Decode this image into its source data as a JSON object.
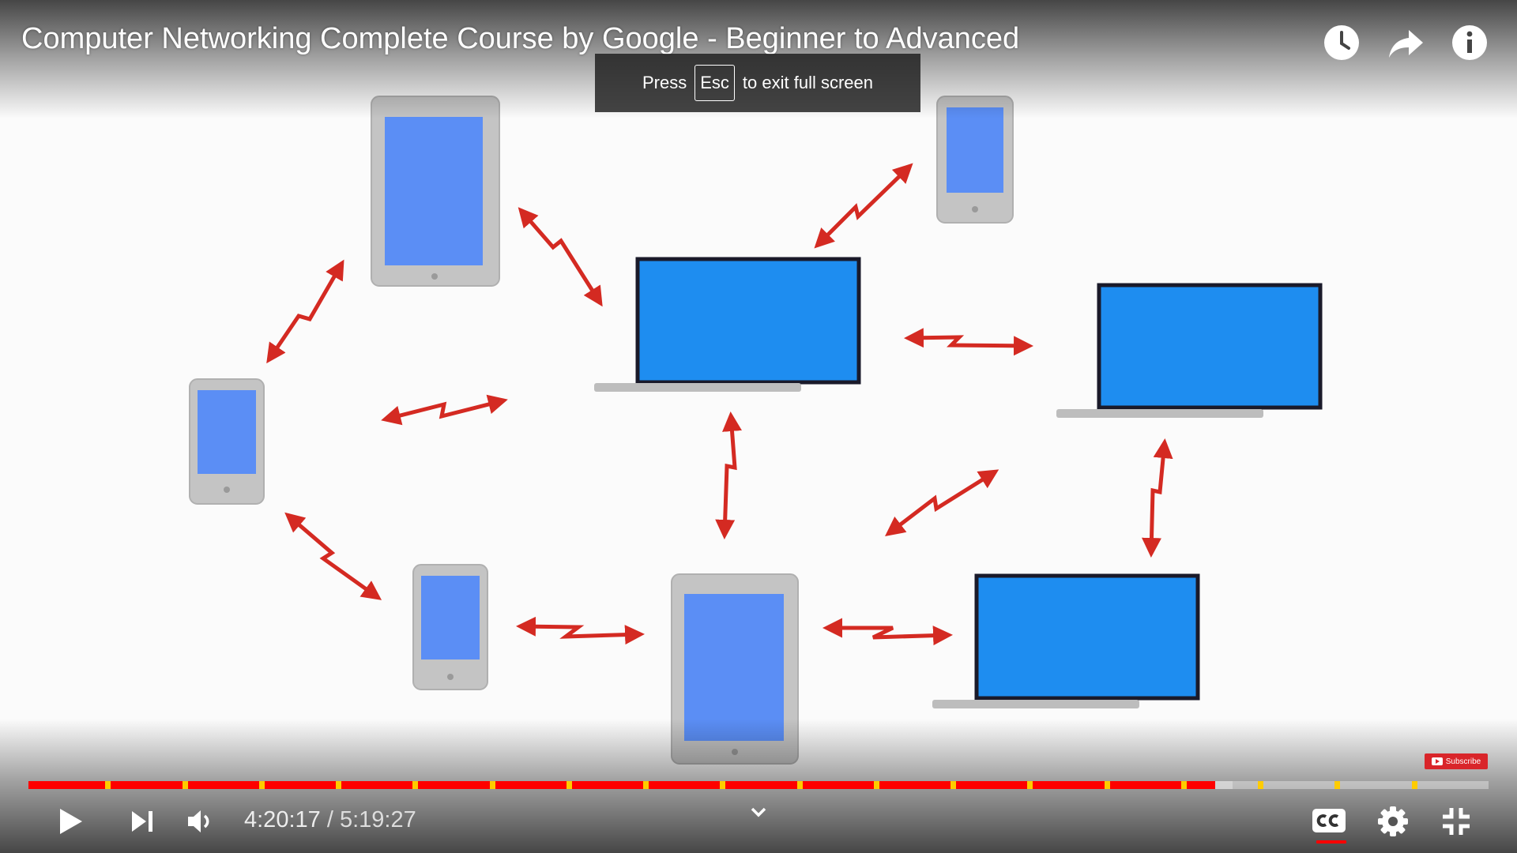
{
  "video": {
    "title": "Computer Networking Complete Course by Google - Beginner to Advanced",
    "content": "Illustration of phones, tablets and laptops exchanging wireless signals"
  },
  "fullscreen_notice": {
    "prefix": "Press",
    "key": "Esc",
    "suffix": "to exit full screen"
  },
  "top_actions": [
    {
      "name": "watch-later-icon"
    },
    {
      "name": "share-icon"
    },
    {
      "name": "info-icon"
    }
  ],
  "subscribe_badge": {
    "label": "Subscribe"
  },
  "player": {
    "current_time": "4:20:17",
    "separator": "/",
    "duration": "5:19:27",
    "progress_fraction": 0.8125,
    "buffered_fraction": 0.8245,
    "chapter_count": 18
  },
  "controls": {
    "icons": [
      "play-icon",
      "next-icon",
      "volume-icon",
      "chevron-down-icon",
      "captions-icon",
      "settings-icon",
      "exit-fullscreen-icon"
    ]
  },
  "colors": {
    "progress_played": "#ff0000",
    "chapter_marker": "#ffcc00",
    "device_screen": "#1e8df0",
    "signal_arrow": "#d42a22"
  }
}
